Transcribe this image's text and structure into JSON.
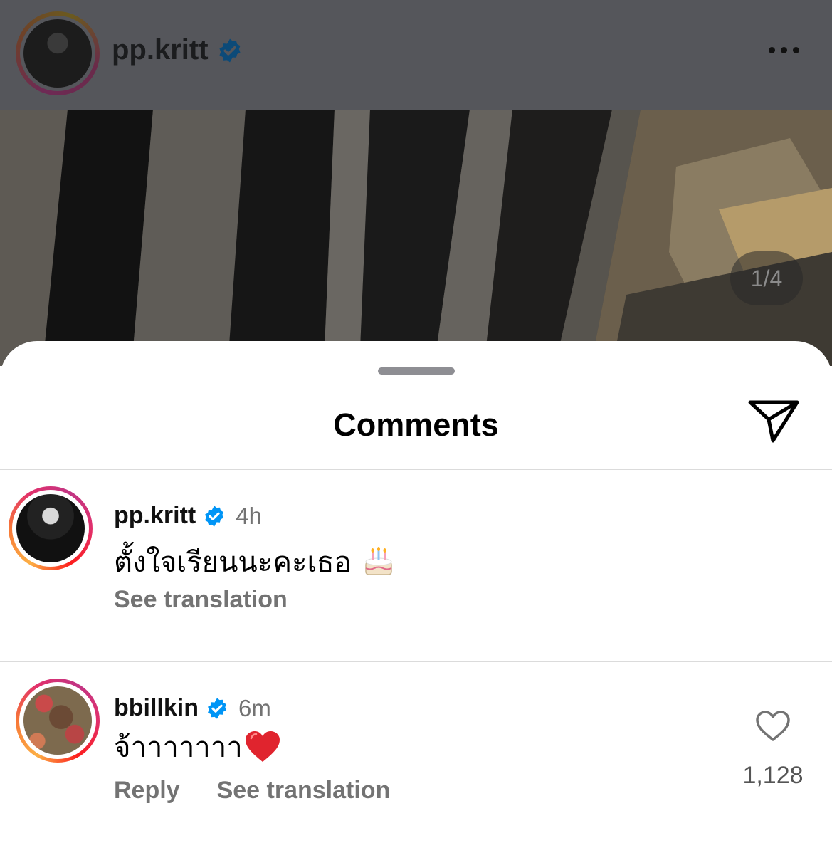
{
  "post": {
    "username": "pp.kritt",
    "verified_icon": "verified-badge-icon",
    "more_icon": "more-options-icon",
    "page_indicator": "1/4"
  },
  "sheet": {
    "title": "Comments",
    "share_icon": "send-icon"
  },
  "comments": [
    {
      "username": "pp.kritt",
      "time": "4h",
      "text": "ตั้งใจเรียนนะคะเธอ",
      "emoji": "birthday-cake-icon",
      "see_translation": "See translation"
    },
    {
      "username": "bbillkin",
      "time": "6m",
      "text": "จ้าาาาาาา",
      "emoji": "red-heart-icon",
      "reply": "Reply",
      "see_translation": "See translation",
      "likes": "1,128"
    }
  ],
  "colors": {
    "verified": "#0095f6",
    "secondary_text": "#737373",
    "overlay_header": "#55565b"
  }
}
